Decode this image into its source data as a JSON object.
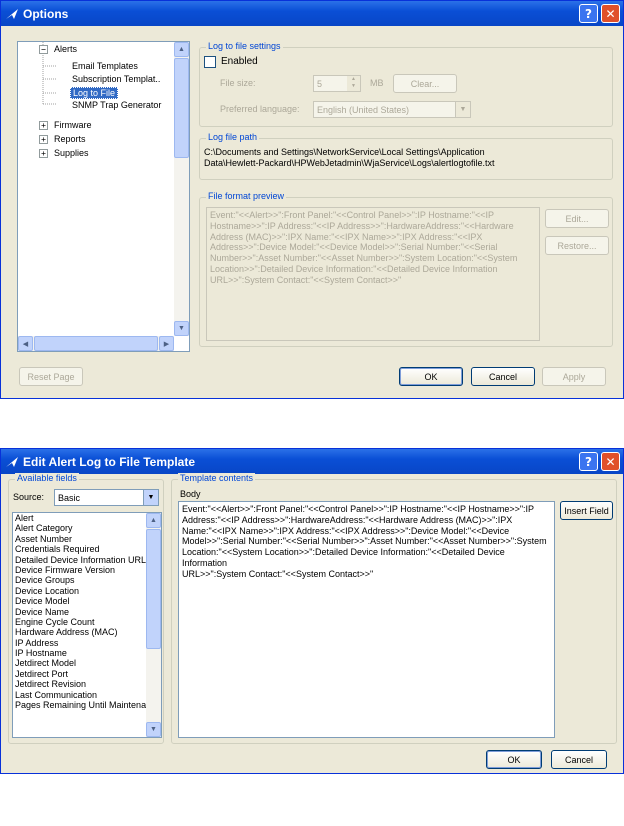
{
  "options": {
    "title": "Options",
    "tree": {
      "items": [
        {
          "label": "Alerts",
          "expander": "−"
        },
        {
          "label": "Email Templates"
        },
        {
          "label": "Subscription Templat.."
        },
        {
          "label": "Log to File"
        },
        {
          "label": "SNMP Trap Generator"
        },
        {
          "label": "Firmware",
          "expander": "+"
        },
        {
          "label": "Reports",
          "expander": "+"
        },
        {
          "label": "Supplies",
          "expander": "+"
        }
      ]
    },
    "log_settings": {
      "legend": "Log to file settings",
      "enabled_label": "Enabled",
      "file_size_label": "File size:",
      "file_size_value": "5",
      "file_size_unit": "MB",
      "clear_label": "Clear...",
      "language_label": "Preferred language:",
      "language_value": "English (United States)"
    },
    "log_path": {
      "legend": "Log file path",
      "line1": "C:\\Documents and Settings\\NetworkService\\Local Settings\\Application",
      "line2": "Data\\Hewlett-Packard\\HPWebJetadmin\\WjaService\\Logs\\alertlogtofile.txt"
    },
    "format_preview": {
      "legend": "File format preview",
      "lines": [
        "Event:\"<<Alert>>\":Front Panel:\"<<Control Panel>>\":IP Hostname:\"<<IP",
        "Hostname>>\":IP Address:\"<<IP Address>>\":HardwareAddress:\"<<Hardware",
        "Address (MAC)>>\":IPX Name:\"<<IPX Name>>\":IPX Address:\"<<IPX",
        "Address>>\":Device Model:\"<<Device Model>>\":Serial Number:\"<<Serial",
        "Number>>\":Asset Number:\"<<Asset Number>>\":System Location:\"<<System",
        "Location>>\":Detailed Device Information:\"<<Detailed Device Information",
        "URL>>\":System Contact:\"<<System Contact>>\""
      ],
      "edit_label": "Edit...",
      "restore_label": "Restore..."
    },
    "buttons": {
      "reset": "Reset Page",
      "ok": "OK",
      "cancel": "Cancel",
      "apply": "Apply"
    }
  },
  "edit_template": {
    "title": "Edit Alert Log to File Template",
    "available": {
      "legend": "Available fields",
      "source_label": "Source:",
      "source_value": "Basic",
      "fields": [
        "Alert",
        "Alert Category",
        "Asset Number",
        "Credentials Required",
        "Detailed Device Information URL",
        "Device Firmware Version",
        "Device Groups",
        "Device Location",
        "Device Model",
        "Device Name",
        "Engine Cycle Count",
        "Hardware Address (MAC)",
        "IP Address",
        "IP Hostname",
        "Jetdirect Model",
        "Jetdirect Port",
        "Jetdirect Revision",
        "Last Communication",
        "Pages Remaining Until Maintenar"
      ]
    },
    "contents": {
      "legend": "Template contents",
      "body_label": "Body",
      "lines": [
        "Event:\"<<Alert>>\":Front Panel:\"<<Control Panel>>\":IP Hostname:\"<<IP Hostname>>\":IP",
        "Address:\"<<IP Address>>\":HardwareAddress:\"<<Hardware Address (MAC)>>\":IPX",
        "Name:\"<<IPX Name>>\":IPX Address:\"<<IPX Address>>\":Device Model:\"<<Device",
        "Model>>\":Serial Number:\"<<Serial Number>>\":Asset Number:\"<<Asset Number>>\":System",
        "Location:\"<<System Location>>\":Detailed Device Information:\"<<Detailed Device Information",
        "URL>>\":System Contact:\"<<System Contact>>\""
      ],
      "insert_label": "Insert Field"
    },
    "buttons": {
      "ok": "OK",
      "cancel": "Cancel"
    }
  }
}
